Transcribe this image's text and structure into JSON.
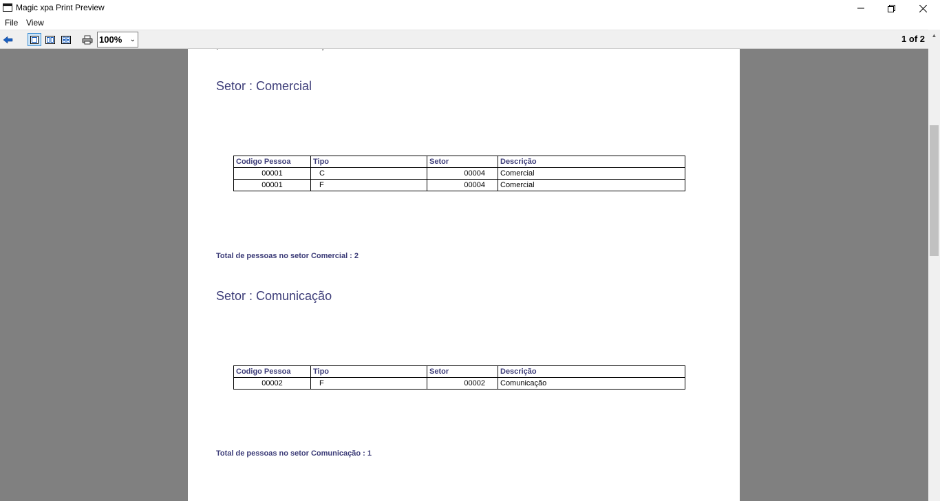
{
  "window": {
    "title": "Magic xpa Print Preview"
  },
  "menu": [
    {
      "label": "File"
    },
    {
      "label": "View"
    }
  ],
  "toolbar": {
    "zoom": "100%",
    "page_indicator": "1 of 2"
  },
  "report": {
    "sections": [
      {
        "title": "Setor : Comercial",
        "headers": [
          "Codigo Pessoa",
          "Tipo",
          "Setor",
          "Descrição"
        ],
        "rows": [
          [
            "00001",
            "C",
            "00004",
            "Comercial"
          ],
          [
            "00001",
            "F",
            "00004",
            "Comercial"
          ]
        ],
        "total": "Total de pessoas no setor Comercial : 2"
      },
      {
        "title": "Setor : Comunicação",
        "headers": [
          "Codigo Pessoa",
          "Tipo",
          "Setor",
          "Descrição"
        ],
        "rows": [
          [
            "00002",
            "F",
            "00002",
            "Comunicação"
          ]
        ],
        "total": "Total de pessoas no setor Comunicação : 1"
      }
    ]
  }
}
